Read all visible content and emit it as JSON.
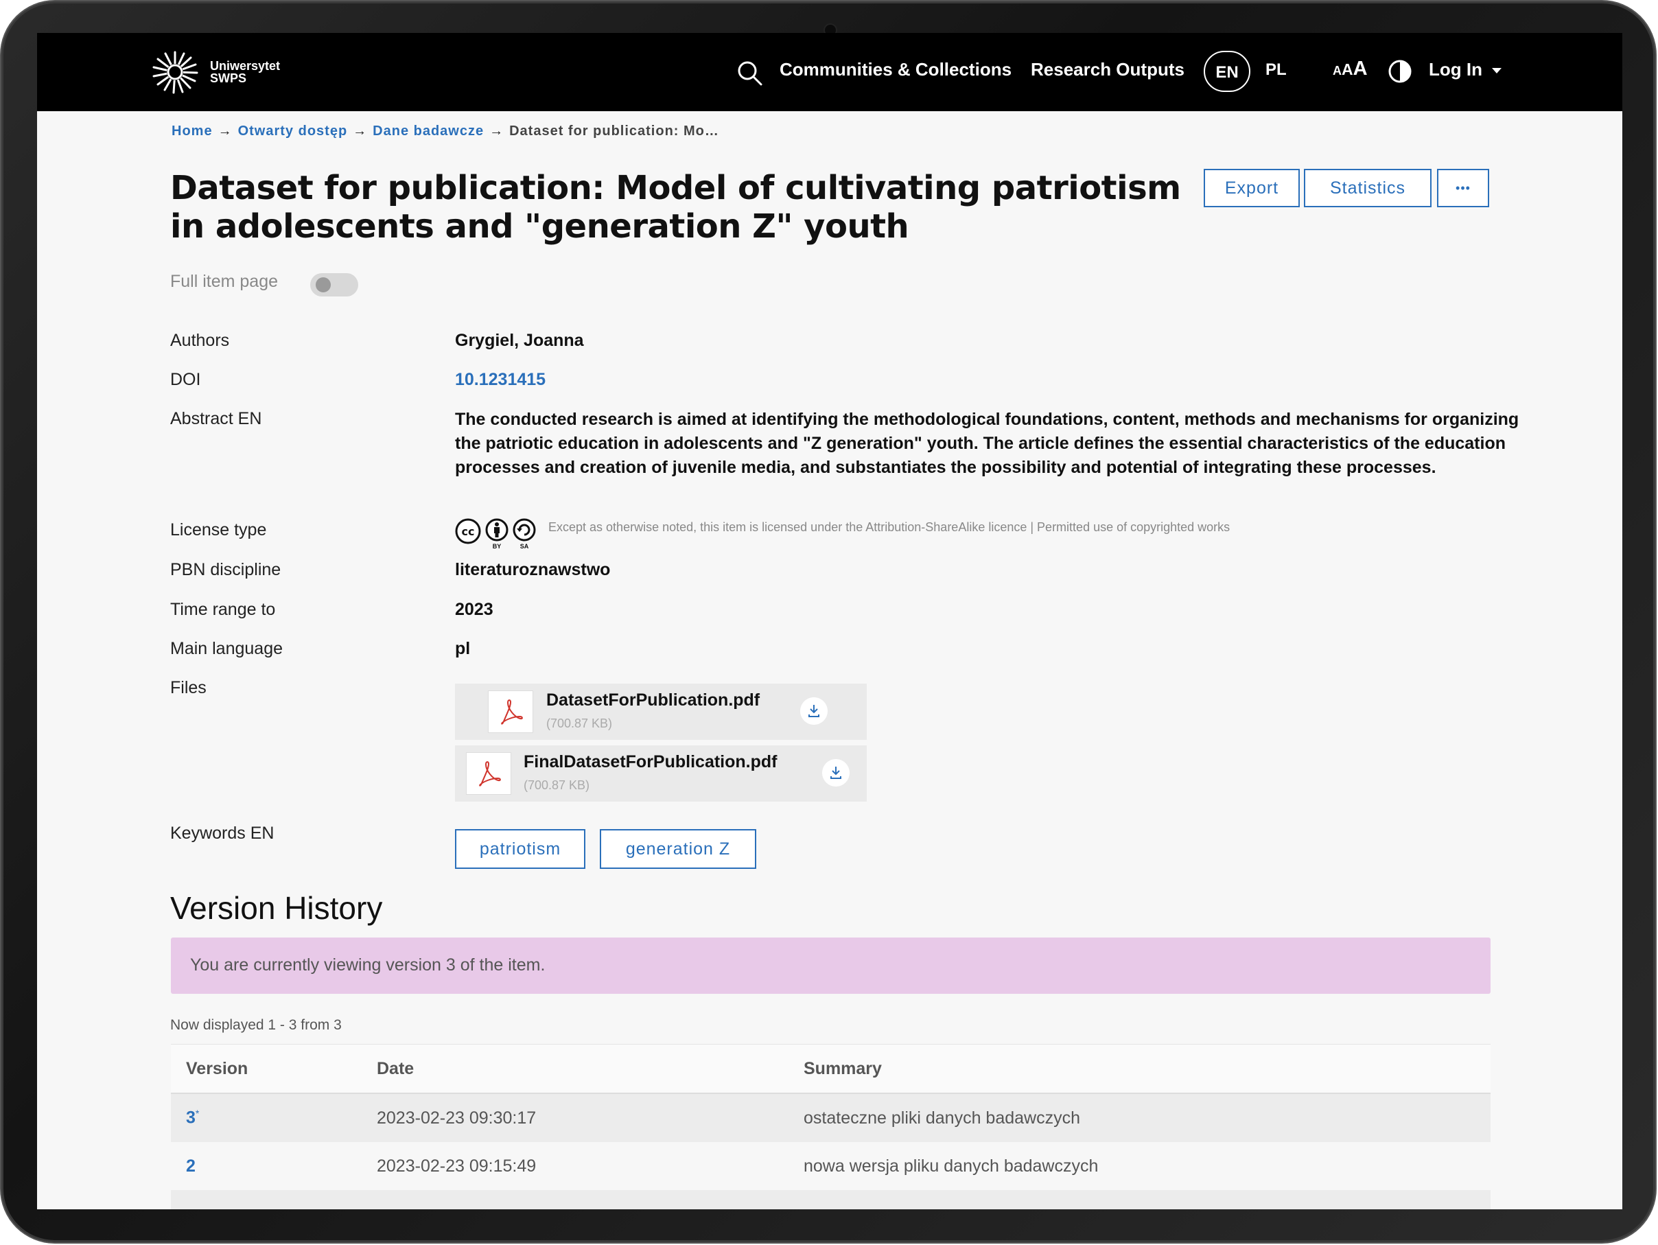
{
  "logo": {
    "line1": "Uniwersytet",
    "line2": "SWPS"
  },
  "nav": {
    "communities": "Communities & Collections",
    "outputs": "Research Outputs",
    "lang_en": "EN",
    "lang_pl": "PL",
    "font_small": "A",
    "font_mid": "A",
    "font_large": "A",
    "login": "Log In"
  },
  "breadcrumb": {
    "home": "Home",
    "open_access": "Otwarty dostęp",
    "research_data": "Dane badawcze",
    "current": "Dataset for publication: Mo…",
    "sep": "→"
  },
  "item": {
    "title": "Dataset for publication: Model of cultivating patriotism in adolescents and \"generation Z\" youth",
    "export": "Export",
    "statistics": "Statistics",
    "more": "•••",
    "full_item_label": "Full item page"
  },
  "metadata": {
    "authors_label": "Authors",
    "authors": "Grygiel, Joanna",
    "doi_label": "DOI",
    "doi": "10.1231415",
    "abstract_label": "Abstract EN",
    "abstract": "The conducted research is aimed at identifying the methodological foundations, content, methods and mechanisms for organizing the patriotic education in adolescents and \"Z generation\" youth. The article defines the essential characteristics of the education processes and creation of juvenile media, and substantiates the possibility and potential of integrating these processes.",
    "license_label": "License type",
    "license_by": "BY",
    "license_sa": "SA",
    "license_text": "Except as otherwise noted, this item is licensed under the Attribution-ShareAlike licence | Permitted use of copyrighted works",
    "pbn_label": "PBN discipline",
    "pbn": "literaturoznawstwo",
    "time_label": "Time range to",
    "time": "2023",
    "lang_label": "Main language",
    "lang": "pl",
    "files_label": "Files",
    "keywords_label": "Keywords EN"
  },
  "files": [
    {
      "name": "DatasetForPublication.pdf",
      "size": "(700.87 KB)"
    },
    {
      "name": "FinalDatasetForPublication.pdf",
      "size": "(700.87 KB)"
    }
  ],
  "keywords": [
    "patriotism",
    "generation Z"
  ],
  "version_history": {
    "title": "Version History",
    "alert": "You are currently viewing version 3 of the item.",
    "displayed": "Now displayed 1 - 3 from 3",
    "headers": [
      "Version",
      "Date",
      "Summary"
    ],
    "rows": [
      {
        "version": "3",
        "star": "*",
        "date": "2023-02-23 09:30:17",
        "summary": "ostateczne pliki danych badawczych"
      },
      {
        "version": "2",
        "star": "",
        "date": "2023-02-23 09:15:49",
        "summary": "nowa wersja pliku danych badawczych"
      }
    ]
  },
  "colors": {
    "accent": "#2a6fba",
    "navbar": "#000000",
    "alert": "#e8c9e8"
  }
}
